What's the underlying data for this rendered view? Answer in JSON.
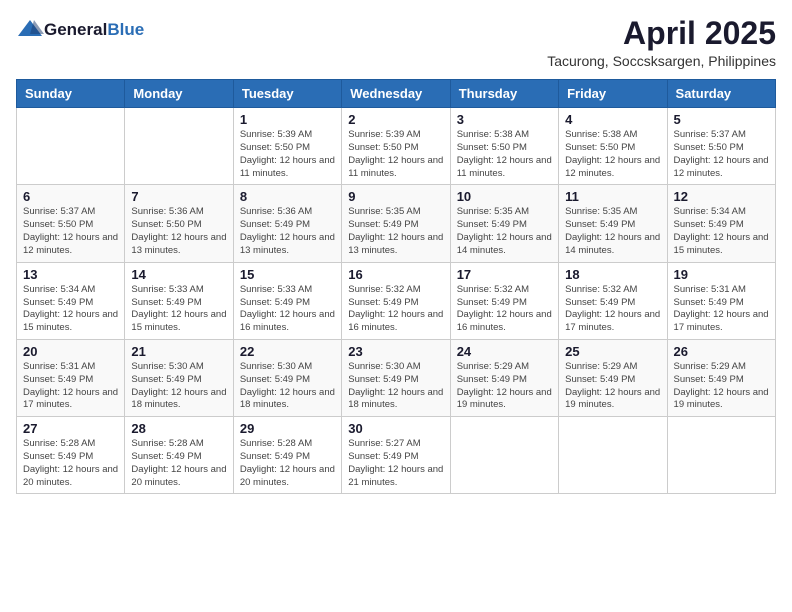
{
  "header": {
    "logo_general": "General",
    "logo_blue": "Blue",
    "month_year": "April 2025",
    "location": "Tacurong, Soccsksargen, Philippines"
  },
  "weekdays": [
    "Sunday",
    "Monday",
    "Tuesday",
    "Wednesday",
    "Thursday",
    "Friday",
    "Saturday"
  ],
  "weeks": [
    [
      {
        "day": "",
        "info": ""
      },
      {
        "day": "",
        "info": ""
      },
      {
        "day": "1",
        "info": "Sunrise: 5:39 AM\nSunset: 5:50 PM\nDaylight: 12 hours and 11 minutes."
      },
      {
        "day": "2",
        "info": "Sunrise: 5:39 AM\nSunset: 5:50 PM\nDaylight: 12 hours and 11 minutes."
      },
      {
        "day": "3",
        "info": "Sunrise: 5:38 AM\nSunset: 5:50 PM\nDaylight: 12 hours and 11 minutes."
      },
      {
        "day": "4",
        "info": "Sunrise: 5:38 AM\nSunset: 5:50 PM\nDaylight: 12 hours and 12 minutes."
      },
      {
        "day": "5",
        "info": "Sunrise: 5:37 AM\nSunset: 5:50 PM\nDaylight: 12 hours and 12 minutes."
      }
    ],
    [
      {
        "day": "6",
        "info": "Sunrise: 5:37 AM\nSunset: 5:50 PM\nDaylight: 12 hours and 12 minutes."
      },
      {
        "day": "7",
        "info": "Sunrise: 5:36 AM\nSunset: 5:50 PM\nDaylight: 12 hours and 13 minutes."
      },
      {
        "day": "8",
        "info": "Sunrise: 5:36 AM\nSunset: 5:49 PM\nDaylight: 12 hours and 13 minutes."
      },
      {
        "day": "9",
        "info": "Sunrise: 5:35 AM\nSunset: 5:49 PM\nDaylight: 12 hours and 13 minutes."
      },
      {
        "day": "10",
        "info": "Sunrise: 5:35 AM\nSunset: 5:49 PM\nDaylight: 12 hours and 14 minutes."
      },
      {
        "day": "11",
        "info": "Sunrise: 5:35 AM\nSunset: 5:49 PM\nDaylight: 12 hours and 14 minutes."
      },
      {
        "day": "12",
        "info": "Sunrise: 5:34 AM\nSunset: 5:49 PM\nDaylight: 12 hours and 15 minutes."
      }
    ],
    [
      {
        "day": "13",
        "info": "Sunrise: 5:34 AM\nSunset: 5:49 PM\nDaylight: 12 hours and 15 minutes."
      },
      {
        "day": "14",
        "info": "Sunrise: 5:33 AM\nSunset: 5:49 PM\nDaylight: 12 hours and 15 minutes."
      },
      {
        "day": "15",
        "info": "Sunrise: 5:33 AM\nSunset: 5:49 PM\nDaylight: 12 hours and 16 minutes."
      },
      {
        "day": "16",
        "info": "Sunrise: 5:32 AM\nSunset: 5:49 PM\nDaylight: 12 hours and 16 minutes."
      },
      {
        "day": "17",
        "info": "Sunrise: 5:32 AM\nSunset: 5:49 PM\nDaylight: 12 hours and 16 minutes."
      },
      {
        "day": "18",
        "info": "Sunrise: 5:32 AM\nSunset: 5:49 PM\nDaylight: 12 hours and 17 minutes."
      },
      {
        "day": "19",
        "info": "Sunrise: 5:31 AM\nSunset: 5:49 PM\nDaylight: 12 hours and 17 minutes."
      }
    ],
    [
      {
        "day": "20",
        "info": "Sunrise: 5:31 AM\nSunset: 5:49 PM\nDaylight: 12 hours and 17 minutes."
      },
      {
        "day": "21",
        "info": "Sunrise: 5:30 AM\nSunset: 5:49 PM\nDaylight: 12 hours and 18 minutes."
      },
      {
        "day": "22",
        "info": "Sunrise: 5:30 AM\nSunset: 5:49 PM\nDaylight: 12 hours and 18 minutes."
      },
      {
        "day": "23",
        "info": "Sunrise: 5:30 AM\nSunset: 5:49 PM\nDaylight: 12 hours and 18 minutes."
      },
      {
        "day": "24",
        "info": "Sunrise: 5:29 AM\nSunset: 5:49 PM\nDaylight: 12 hours and 19 minutes."
      },
      {
        "day": "25",
        "info": "Sunrise: 5:29 AM\nSunset: 5:49 PM\nDaylight: 12 hours and 19 minutes."
      },
      {
        "day": "26",
        "info": "Sunrise: 5:29 AM\nSunset: 5:49 PM\nDaylight: 12 hours and 19 minutes."
      }
    ],
    [
      {
        "day": "27",
        "info": "Sunrise: 5:28 AM\nSunset: 5:49 PM\nDaylight: 12 hours and 20 minutes."
      },
      {
        "day": "28",
        "info": "Sunrise: 5:28 AM\nSunset: 5:49 PM\nDaylight: 12 hours and 20 minutes."
      },
      {
        "day": "29",
        "info": "Sunrise: 5:28 AM\nSunset: 5:49 PM\nDaylight: 12 hours and 20 minutes."
      },
      {
        "day": "30",
        "info": "Sunrise: 5:27 AM\nSunset: 5:49 PM\nDaylight: 12 hours and 21 minutes."
      },
      {
        "day": "",
        "info": ""
      },
      {
        "day": "",
        "info": ""
      },
      {
        "day": "",
        "info": ""
      }
    ]
  ]
}
